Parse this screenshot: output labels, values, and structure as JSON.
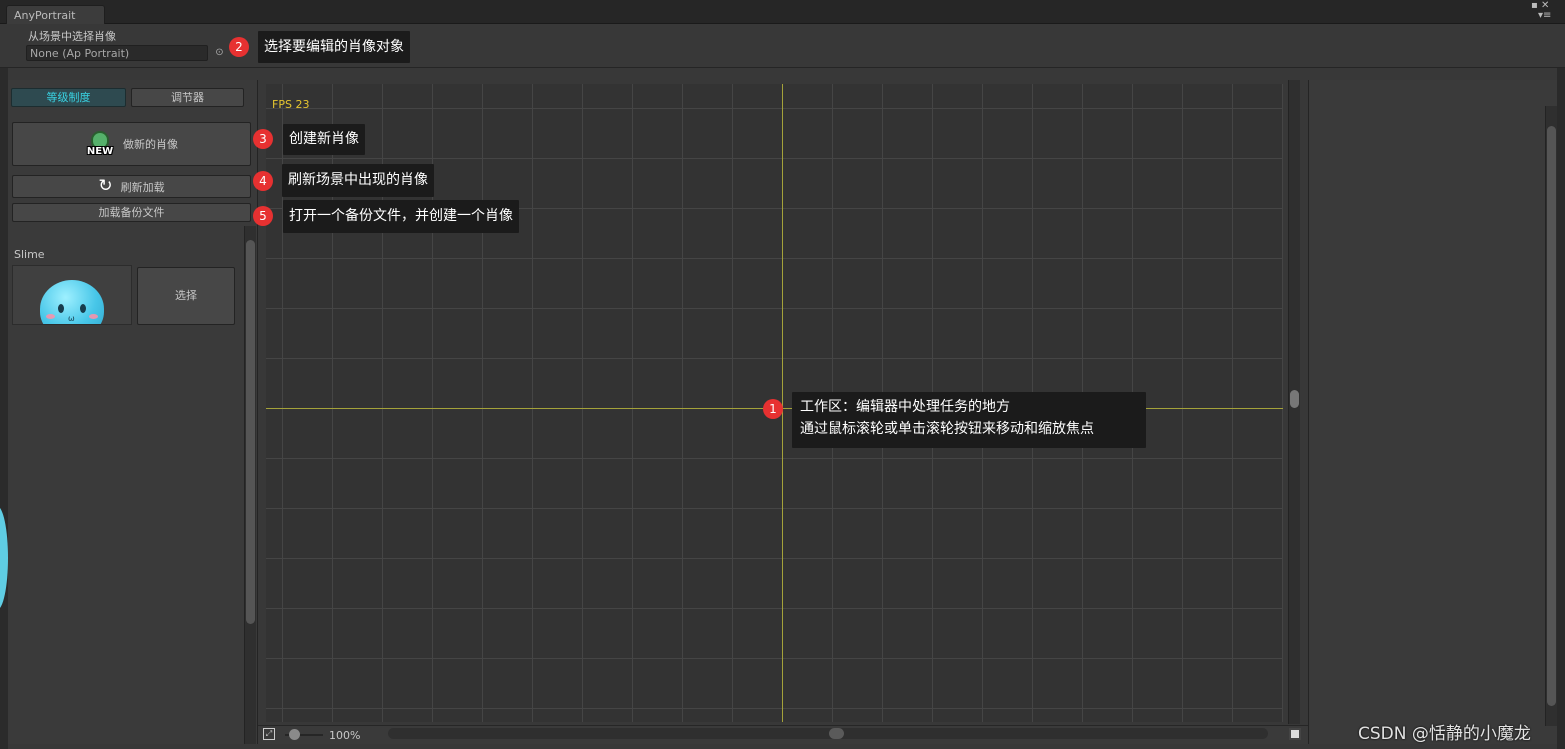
{
  "window": {
    "tab_title": "AnyPortrait",
    "controls": [
      "▪ ✕",
      "▾≡"
    ]
  },
  "header": {
    "field_label": "从场景中选择肖像",
    "object_field_value": "None (Ap Portrait)"
  },
  "left_panel": {
    "tabs": [
      {
        "label": "等级制度",
        "active": true
      },
      {
        "label": "调节器",
        "active": false
      }
    ],
    "new_portrait_button": "做新的肖像",
    "new_badge_text": "NEW",
    "refresh_button": "刷新加载",
    "load_backup_button": "加载备份文件",
    "portraits": [
      {
        "name": "Slime",
        "select_label": "选择"
      }
    ]
  },
  "viewport": {
    "fps_text": "FPS 23",
    "zoom_text": "100%"
  },
  "annotations": [
    {
      "number": "1",
      "lines": [
        "工作区：编辑器中处理任务的地方",
        "通过鼠标滚轮或单击滚轮按钮来移动和缩放焦点"
      ]
    },
    {
      "number": "2",
      "text": "选择要编辑的肖像对象"
    },
    {
      "number": "3",
      "text": "创建新肖像"
    },
    {
      "number": "4",
      "text": "刷新场景中出现的肖像"
    },
    {
      "number": "5",
      "text": "打开一个备份文件，并创建一个肖像"
    }
  ],
  "watermark": "CSDN @恬静的小魔龙",
  "colors": {
    "accent_tab": "#39d3e3",
    "axis": "#a4a23a",
    "fps": "#e5c530",
    "badge": "#e73131"
  }
}
